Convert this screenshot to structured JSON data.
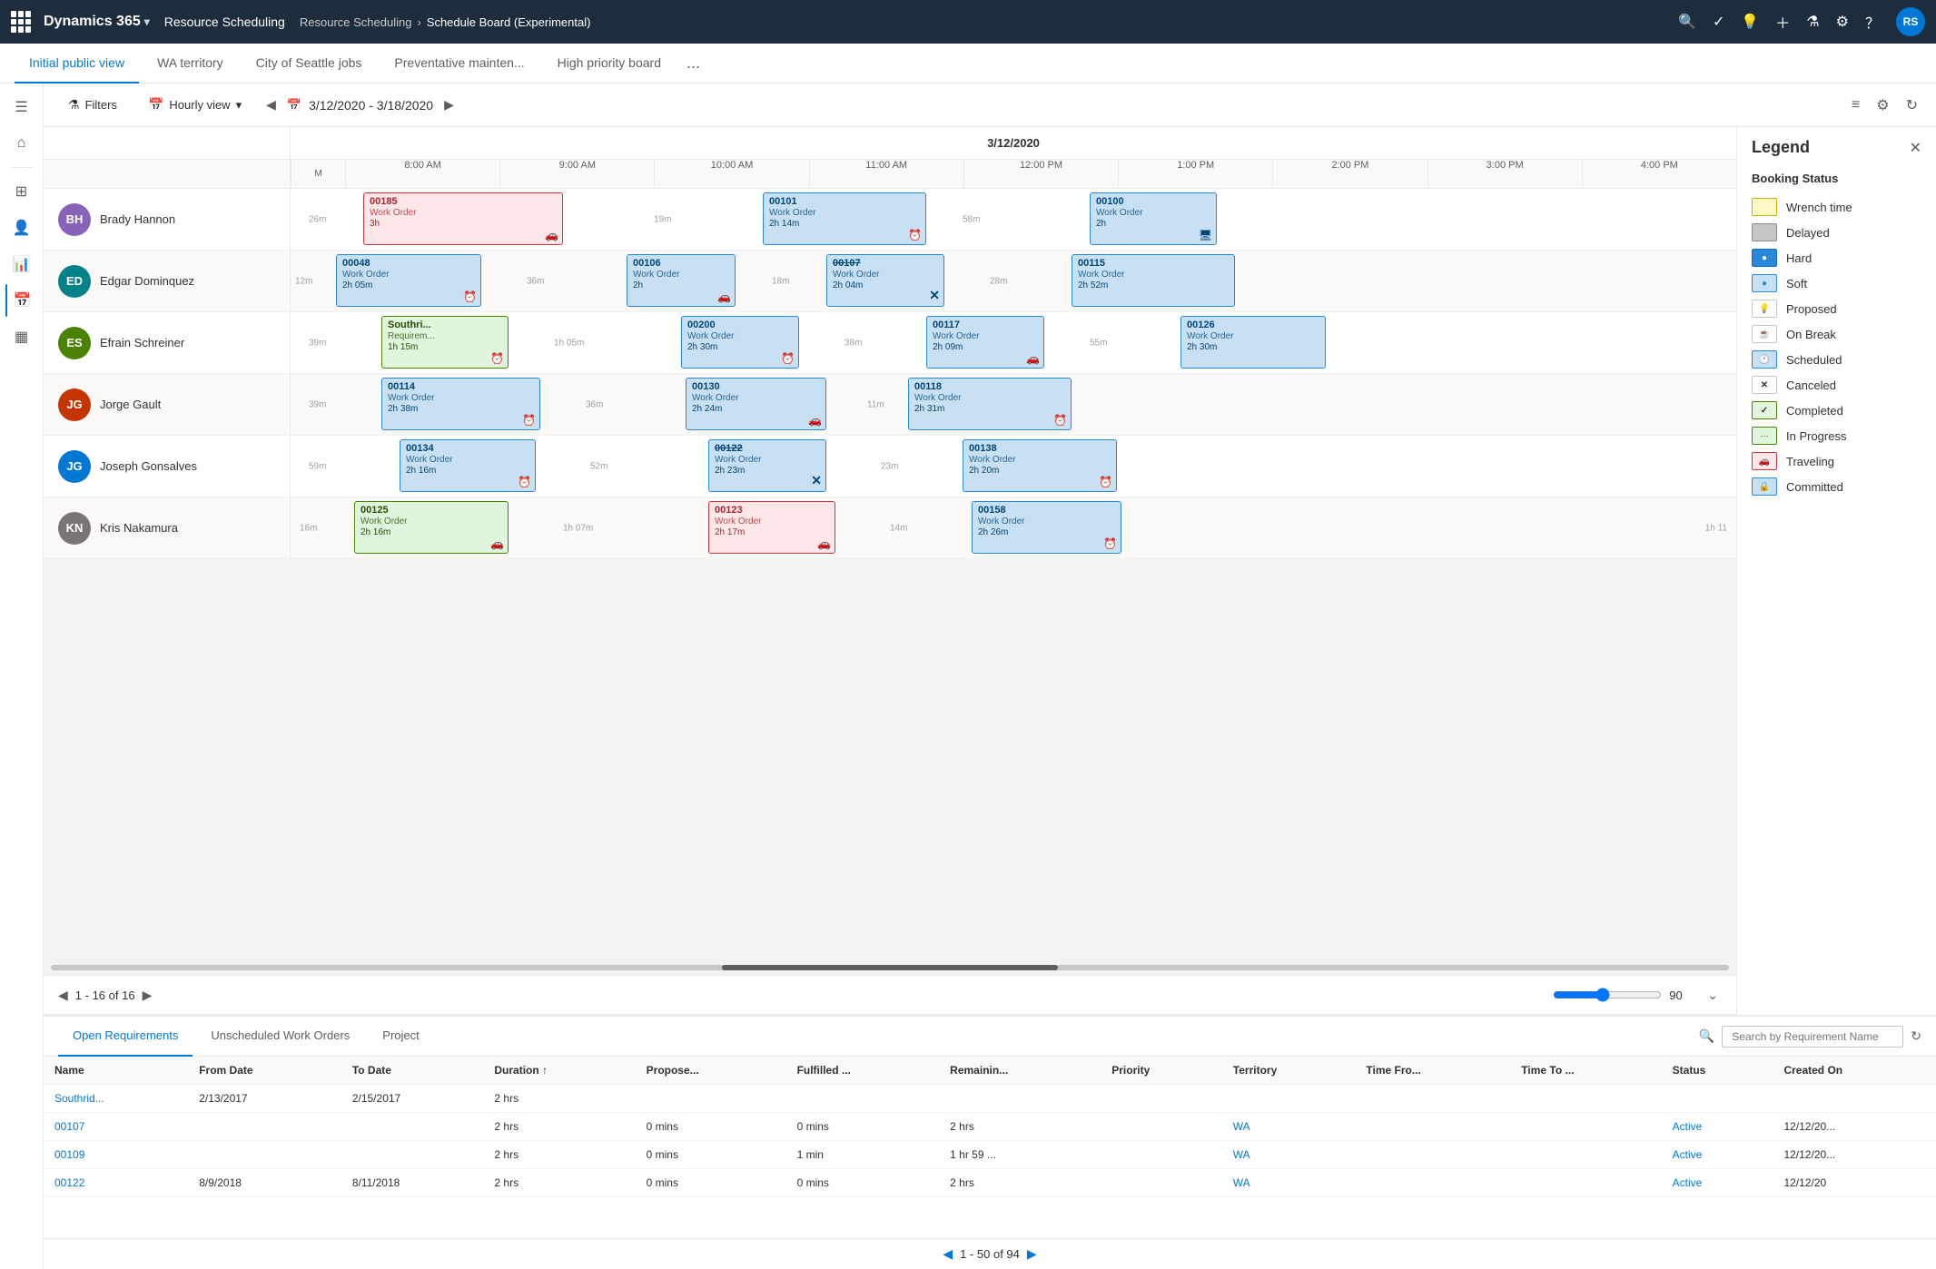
{
  "topbar": {
    "brand": "Dynamics 365",
    "module": "Resource Scheduling",
    "breadcrumb": [
      "Resource Scheduling",
      "Schedule Board (Experimental)"
    ],
    "icons": [
      "search",
      "checklist",
      "lightbulb",
      "plus",
      "filter",
      "settings",
      "help",
      "user"
    ]
  },
  "tabs": {
    "items": [
      {
        "label": "Initial public view",
        "active": true
      },
      {
        "label": "WA territory",
        "active": false
      },
      {
        "label": "City of Seattle jobs",
        "active": false
      },
      {
        "label": "Preventative mainten...",
        "active": false
      },
      {
        "label": "High priority board",
        "active": false
      },
      {
        "label": "...",
        "active": false
      }
    ]
  },
  "toolbar": {
    "filters_label": "Filters",
    "view_label": "Hourly view",
    "date_range": "3/12/2020 - 3/18/2020"
  },
  "search": {
    "placeholder": "Search"
  },
  "schedule": {
    "date": "3/12/2020",
    "time_slots": [
      "8:00 AM",
      "9:00 AM",
      "10:00 AM",
      "11:00 AM",
      "12:00 PM",
      "1:00 PM",
      "2:00 PM",
      "3:00 PM",
      "4:00 PM"
    ]
  },
  "resources": [
    {
      "name": "Brady Hannon",
      "initials": "BH",
      "color": "#8764b8"
    },
    {
      "name": "Edgar Dominquez",
      "initials": "ED",
      "color": "#038387"
    },
    {
      "name": "Efrain Schreiner",
      "initials": "ES",
      "color": "#498205"
    },
    {
      "name": "Jorge Gault",
      "initials": "JG",
      "color": "#c43501"
    },
    {
      "name": "Joseph Gonsalves",
      "initials": "JG2",
      "color": "#0078d4"
    },
    {
      "name": "Kris Nakamura",
      "initials": "KN",
      "color": "#7a7574"
    }
  ],
  "legend": {
    "title": "Legend",
    "section": "Booking Status",
    "items": [
      {
        "label": "Wrench time",
        "swatch": "yellow"
      },
      {
        "label": "Delayed",
        "swatch": "gray"
      },
      {
        "label": "Hard",
        "swatch": "blue-dark",
        "icon": "●"
      },
      {
        "label": "Soft",
        "swatch": "blue-light",
        "icon": "●"
      },
      {
        "label": "Proposed",
        "swatch": "white",
        "icon": "💡"
      },
      {
        "label": "On Break",
        "swatch": "break",
        "icon": "☕"
      },
      {
        "label": "Scheduled",
        "swatch": "scheduled",
        "icon": "🕐"
      },
      {
        "label": "Canceled",
        "swatch": "canceled",
        "icon": "✕"
      },
      {
        "label": "Completed",
        "swatch": "completed",
        "icon": "✓"
      },
      {
        "label": "In Progress",
        "swatch": "inprogress",
        "icon": "···"
      },
      {
        "label": "Traveling",
        "swatch": "traveling",
        "icon": "🚗"
      },
      {
        "label": "Committed",
        "swatch": "committed",
        "icon": "🔒"
      }
    ]
  },
  "pagination": {
    "current": "1 - 16 of 16",
    "zoom": "90"
  },
  "bottom_tabs": [
    {
      "label": "Open Requirements",
      "active": true
    },
    {
      "label": "Unscheduled Work Orders",
      "active": false
    },
    {
      "label": "Project",
      "active": false
    }
  ],
  "bottom_search": {
    "placeholder": "Search by Requirement Name"
  },
  "table": {
    "columns": [
      "Name",
      "From Date",
      "To Date",
      "Duration ↑",
      "Propose...",
      "Fulfilled ...",
      "Remainin...",
      "Priority",
      "Territory",
      "Time Fro...",
      "Time To ...",
      "Status",
      "Created On"
    ],
    "rows": [
      {
        "name": "Southrid...",
        "fromDate": "2/13/2017",
        "toDate": "2/15/2017",
        "duration": "2 hrs",
        "proposed": "",
        "fulfilled": "",
        "remaining": "",
        "priority": "",
        "territory": "",
        "timefrom": "",
        "timeto": "",
        "status": "",
        "created": "",
        "link": true
      },
      {
        "name": "00107",
        "fromDate": "",
        "toDate": "",
        "duration": "2 hrs",
        "proposed": "0 mins",
        "fulfilled": "0 mins",
        "remaining": "2 hrs",
        "priority": "",
        "territory": "WA",
        "timefrom": "",
        "timeto": "",
        "status": "Active",
        "created": "12/12/20...",
        "link": true
      },
      {
        "name": "00109",
        "fromDate": "",
        "toDate": "",
        "duration": "2 hrs",
        "proposed": "0 mins",
        "fulfilled": "1 min",
        "remaining": "1 hr 59 ...",
        "priority": "",
        "territory": "WA",
        "timefrom": "",
        "timeto": "",
        "status": "Active",
        "created": "12/12/20...",
        "link": true
      },
      {
        "name": "00122",
        "fromDate": "8/9/2018",
        "toDate": "8/11/2018",
        "duration": "2 hrs",
        "proposed": "0 mins",
        "fulfilled": "0 mins",
        "remaining": "2 hrs",
        "priority": "",
        "territory": "WA",
        "timefrom": "",
        "timeto": "",
        "status": "Active",
        "created": "12/12/20",
        "link": true
      }
    ]
  },
  "bottom_pagination": {
    "info": "1 - 50 of 94"
  },
  "left_sidebar": {
    "icons": [
      "menu",
      "home",
      "sitemap",
      "people",
      "chart",
      "calendar",
      "grid"
    ]
  }
}
